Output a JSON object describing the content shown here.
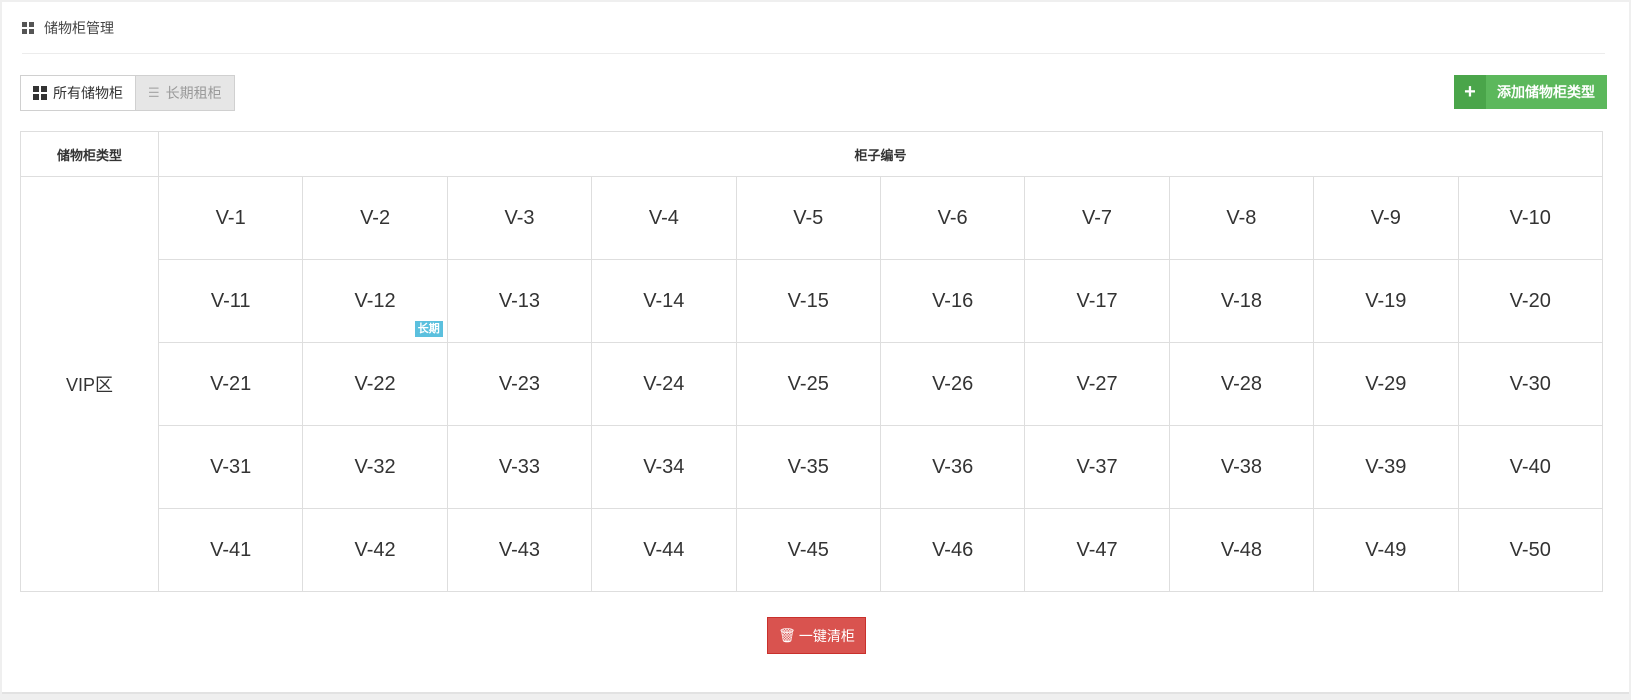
{
  "header": {
    "title": "储物柜管理",
    "icon": "grid-icon"
  },
  "toolbar": {
    "tab_all": "所有储物柜",
    "tab_long": "长期租柜",
    "add_label": "添加储物柜类型",
    "add_icon": "+"
  },
  "table": {
    "col_type": "储物柜类型",
    "col_number": "柜子编号",
    "zone": "VIP区",
    "rows": [
      [
        "V-1",
        "V-2",
        "V-3",
        "V-4",
        "V-5",
        "V-6",
        "V-7",
        "V-8",
        "V-9",
        "V-10"
      ],
      [
        "V-11",
        "V-12",
        "V-13",
        "V-14",
        "V-15",
        "V-16",
        "V-17",
        "V-18",
        "V-19",
        "V-20"
      ],
      [
        "V-21",
        "V-22",
        "V-23",
        "V-24",
        "V-25",
        "V-26",
        "V-27",
        "V-28",
        "V-29",
        "V-30"
      ],
      [
        "V-31",
        "V-32",
        "V-33",
        "V-34",
        "V-35",
        "V-36",
        "V-37",
        "V-38",
        "V-39",
        "V-40"
      ],
      [
        "V-41",
        "V-42",
        "V-43",
        "V-44",
        "V-45",
        "V-46",
        "V-47",
        "V-48",
        "V-49",
        "V-50"
      ]
    ],
    "long_term_cells": [
      "V-12"
    ],
    "long_term_badge": "长期"
  },
  "actions": {
    "clear_all": "一键清柜"
  },
  "colors": {
    "add_green": "#5cb85c",
    "clear_red": "#d9534f",
    "badge_blue": "#5bc0de"
  }
}
